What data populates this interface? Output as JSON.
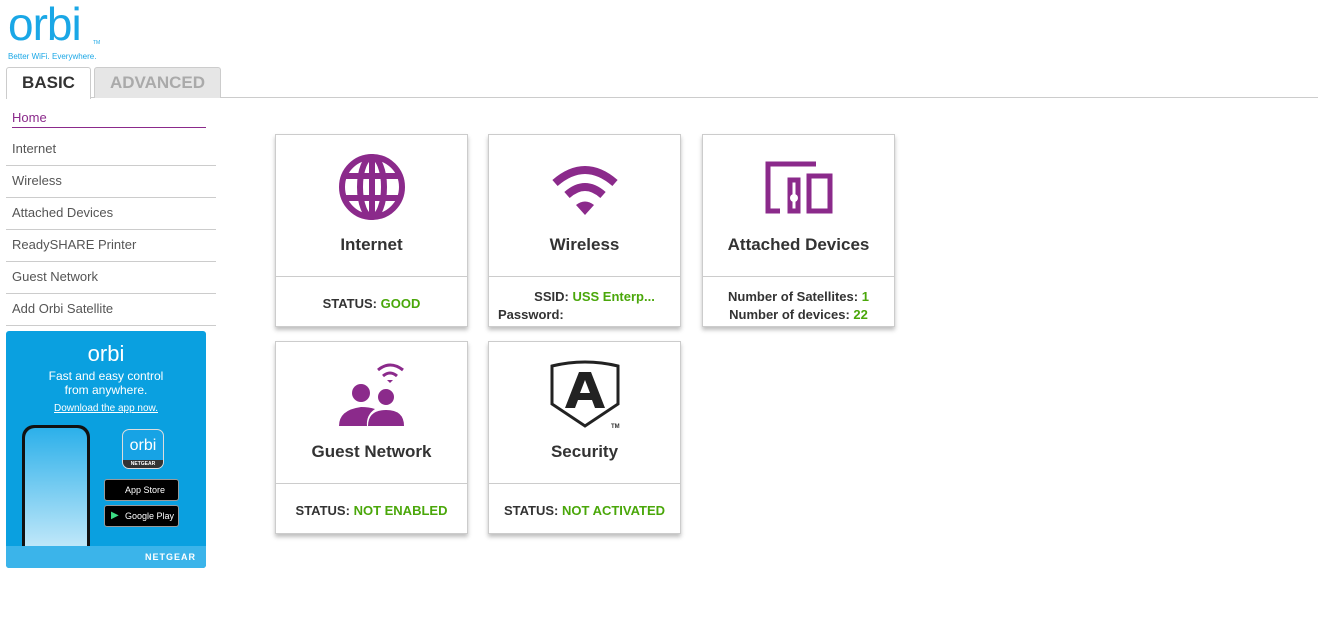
{
  "logo": {
    "word": "orbi",
    "tm": "TM",
    "tagline": "Better WiFi. Everywhere."
  },
  "tabs": [
    {
      "label": "BASIC",
      "active": true
    },
    {
      "label": "ADVANCED",
      "active": false
    }
  ],
  "sidebar": {
    "items": [
      {
        "label": "Home"
      },
      {
        "label": "Internet"
      },
      {
        "label": "Wireless"
      },
      {
        "label": "Attached Devices"
      },
      {
        "label": "ReadySHARE Printer"
      },
      {
        "label": "Guest Network"
      },
      {
        "label": "Add Orbi Satellite"
      }
    ]
  },
  "banner": {
    "brand": "orbi",
    "text1": "Fast and easy control",
    "text2": "from anywhere.",
    "link": "Download the app now.",
    "app_icon": "orbi",
    "app_icon_sub": "NETGEAR",
    "app_store": "App Store",
    "google_play": "Google Play",
    "footer": "NETGEAR"
  },
  "cards": {
    "internet": {
      "title": "Internet",
      "status_label": "STATUS:",
      "status": "GOOD"
    },
    "wireless": {
      "title": "Wireless",
      "ssid_label": "SSID:",
      "ssid": "USS Enterp...",
      "password_label": "Password:"
    },
    "devices": {
      "title": "Attached Devices",
      "sat_label": "Number of Satellites:",
      "sat": "1",
      "dev_label": "Number of devices:",
      "dev": "22"
    },
    "guest": {
      "title": "Guest Network",
      "status_label": "STATUS:",
      "status": "NOT ENABLED"
    },
    "security": {
      "title": "Security",
      "status_label": "STATUS:",
      "status": "NOT ACTIVATED",
      "tm": "TM"
    }
  },
  "colors": {
    "accent": "#8b2a8b",
    "status_green": "#4aa70a",
    "brand_blue": "#1aa7e6"
  }
}
